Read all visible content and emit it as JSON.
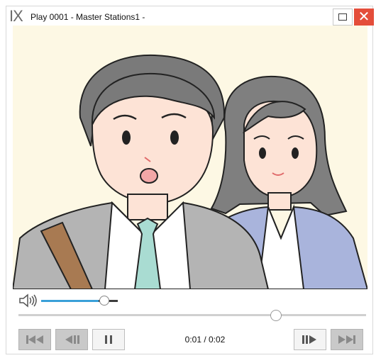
{
  "window": {
    "logo": "IX",
    "title": "Play  0001 - Master Stations1 -",
    "close_glyph": "✕"
  },
  "video": {
    "description_icon": "video-frame"
  },
  "volume": {
    "level": 0.82,
    "icon": "speaker-icon"
  },
  "seek": {
    "position": 0.74
  },
  "controls": {
    "time_display": "0:01 / 0:02",
    "buttons": [
      {
        "name": "skip-to-start",
        "enabled": false
      },
      {
        "name": "step-back",
        "enabled": false
      },
      {
        "name": "pause",
        "enabled": true
      },
      {
        "name": "step-forward",
        "enabled": true
      },
      {
        "name": "skip-to-end",
        "enabled": false
      }
    ]
  },
  "colors": {
    "accent": "#3aa0d8",
    "close_button": "#e44d3a",
    "video_background": "#fdf8e4"
  }
}
